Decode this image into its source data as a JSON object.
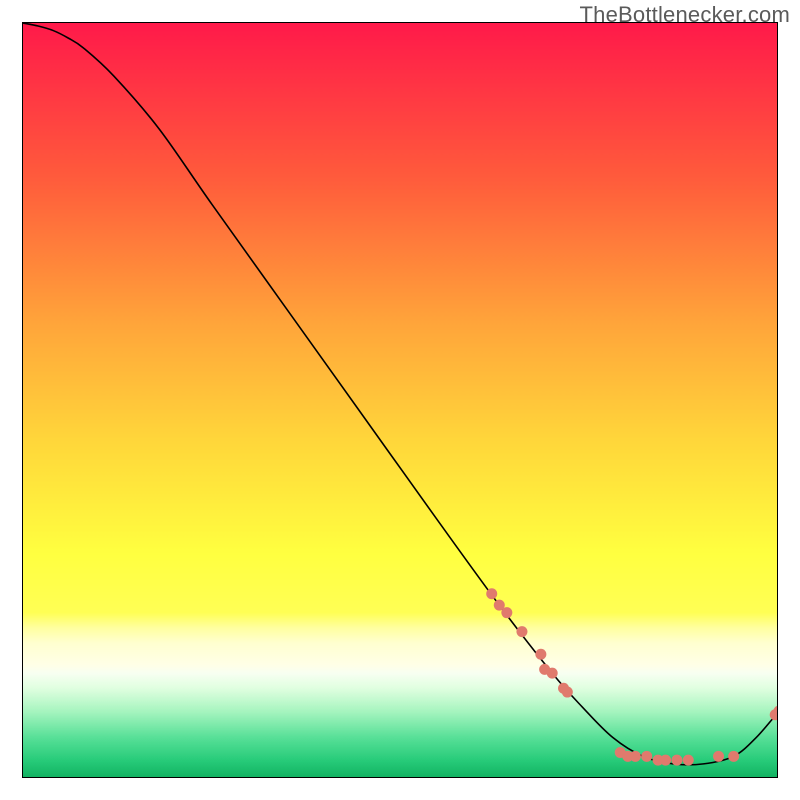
{
  "watermark": {
    "label": "TheBottlenecker.com"
  },
  "chart_data": {
    "type": "line",
    "title": "",
    "xlabel": "",
    "ylabel": "",
    "xlim": [
      0,
      100
    ],
    "ylim": [
      0,
      100
    ],
    "grid": false,
    "legend": false,
    "axes_ticks_shown": false,
    "background": {
      "kind": "vertical-gradient",
      "stops": [
        {
          "pos": 0.0,
          "color": "#ff1a4a"
        },
        {
          "pos": 0.2,
          "color": "#ff5a3c"
        },
        {
          "pos": 0.4,
          "color": "#ffa63a"
        },
        {
          "pos": 0.55,
          "color": "#ffd63a"
        },
        {
          "pos": 0.7,
          "color": "#ffff40"
        },
        {
          "pos": 0.78,
          "color": "#ffff55"
        },
        {
          "pos": 0.8,
          "color": "#ffffa0"
        },
        {
          "pos": 0.82,
          "color": "#ffffd0"
        },
        {
          "pos": 0.85,
          "color": "#ffffe8"
        },
        {
          "pos": 0.86,
          "color": "#f8fff2"
        },
        {
          "pos": 0.88,
          "color": "#e0ffe0"
        },
        {
          "pos": 0.91,
          "color": "#a8f5c0"
        },
        {
          "pos": 0.945,
          "color": "#58e098"
        },
        {
          "pos": 0.975,
          "color": "#28cc7a"
        },
        {
          "pos": 1.0,
          "color": "#10b060"
        }
      ]
    },
    "curve": {
      "name": "bottleneck-curve",
      "color": "#000000",
      "width": 1.6,
      "x": [
        0,
        2,
        4,
        6,
        8,
        12,
        18,
        25,
        35,
        45,
        55,
        63,
        70,
        74,
        78,
        82,
        86,
        90,
        94,
        97,
        100
      ],
      "y": [
        100,
        99.6,
        99.0,
        98.0,
        96.7,
        93.0,
        86.0,
        76.0,
        62.0,
        48.0,
        34.0,
        23.0,
        14.0,
        9.5,
        5.5,
        3.0,
        2.0,
        2.0,
        3.0,
        5.5,
        9.0
      ]
    },
    "scatter": {
      "name": "sample-points",
      "color": "#e07a6d",
      "radius": 5.5,
      "points": [
        {
          "x": 62,
          "y": 24.5
        },
        {
          "x": 63,
          "y": 23.0
        },
        {
          "x": 64,
          "y": 22.0
        },
        {
          "x": 66,
          "y": 19.5
        },
        {
          "x": 68.5,
          "y": 16.5
        },
        {
          "x": 69,
          "y": 14.5
        },
        {
          "x": 70,
          "y": 14.0
        },
        {
          "x": 71.5,
          "y": 12.0
        },
        {
          "x": 72,
          "y": 11.5
        },
        {
          "x": 79,
          "y": 3.5
        },
        {
          "x": 80,
          "y": 3.0
        },
        {
          "x": 81,
          "y": 3.0
        },
        {
          "x": 82.5,
          "y": 3.0
        },
        {
          "x": 84,
          "y": 2.5
        },
        {
          "x": 85,
          "y": 2.5
        },
        {
          "x": 86.5,
          "y": 2.5
        },
        {
          "x": 88,
          "y": 2.5
        },
        {
          "x": 92,
          "y": 3.0
        },
        {
          "x": 94,
          "y": 3.0
        },
        {
          "x": 99.5,
          "y": 8.5
        },
        {
          "x": 100,
          "y": 9.0
        }
      ]
    }
  }
}
